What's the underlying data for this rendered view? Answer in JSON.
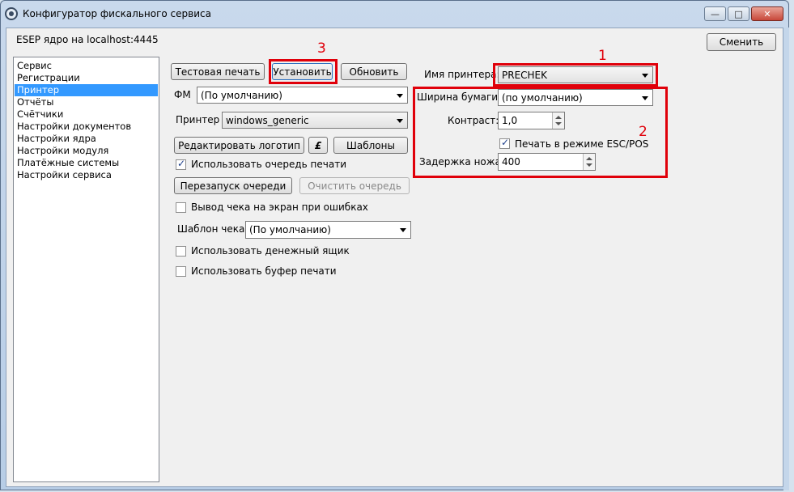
{
  "window": {
    "title": "Конфигуратор фискального сервиса",
    "min_glyph": "—",
    "max_glyph": "□",
    "close_glyph": "✕"
  },
  "header": {
    "server": "ESEP ядро на localhost:4445",
    "change_button": "Сменить"
  },
  "sidebar": {
    "items": [
      {
        "label": "Сервис"
      },
      {
        "label": "Регистрации"
      },
      {
        "label": "Принтер",
        "selected": true
      },
      {
        "label": "Отчёты"
      },
      {
        "label": "Счётчики"
      },
      {
        "label": "Настройки документов"
      },
      {
        "label": "Настройки ядра"
      },
      {
        "label": "Настройки модуля"
      },
      {
        "label": "Платёжные системы"
      },
      {
        "label": "Настройки сервиса"
      }
    ]
  },
  "toolbar": {
    "test_print": "Тестовая печать",
    "install": "Установить",
    "refresh": "Обновить"
  },
  "fm": {
    "label": "ФМ",
    "value": "(По умолчанию)"
  },
  "printer": {
    "label": "Принтер",
    "value": "windows_generic"
  },
  "logo": {
    "edit_button": "Редактировать логотип",
    "symbol_button": "£",
    "templates_button": "Шаблоны"
  },
  "queue": {
    "use_queue_label": "Использовать очередь печати",
    "use_queue_checked": true,
    "restart_button": "Перезапуск очереди",
    "clear_button": "Очистить очередь"
  },
  "options": {
    "show_on_error_label": "Вывод чека на экран при ошибках",
    "show_on_error_checked": false,
    "receipt_template_label": "Шаблон чека",
    "receipt_template_value": "(По умолчанию)",
    "cash_drawer_label": "Использовать денежный ящик",
    "cash_drawer_checked": false,
    "print_buffer_label": "Использовать буфер печати",
    "print_buffer_checked": false
  },
  "printer_settings": {
    "printer_name_label": "Имя принтера:",
    "printer_name_value": "PRECHEK",
    "paper_width_label": "Ширина бумаги:",
    "paper_width_value": "(по умолчанию)",
    "contrast_label": "Контраст:",
    "contrast_value": "1,0",
    "escpos_label": "Печать в режиме ESC/POS",
    "escpos_checked": true,
    "cutter_delay_label": "Задержка ножа:",
    "cutter_delay_value": "400"
  },
  "annotations": {
    "mark_1": "1",
    "mark_2": "2",
    "mark_3": "3",
    "color": "#e0000a"
  }
}
